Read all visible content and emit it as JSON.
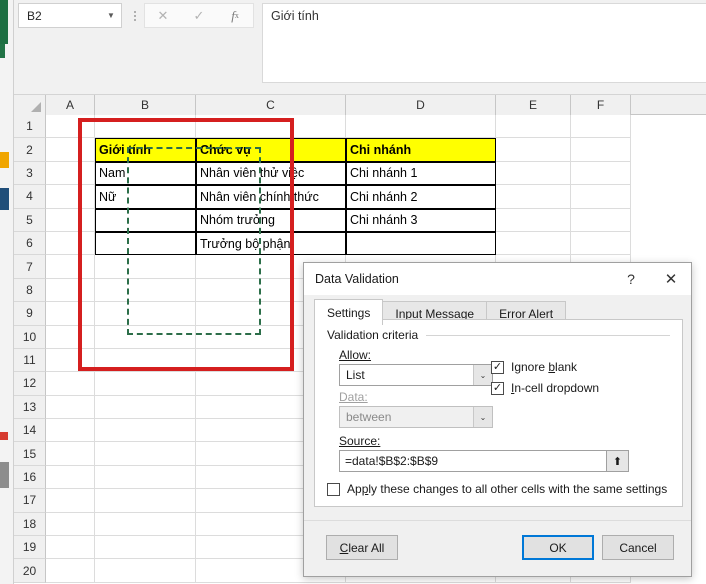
{
  "formula_bar": {
    "name_box_value": "B2",
    "name_box_caret": "▼",
    "cancel_icon": "✕",
    "enter_icon": "✓",
    "fx_label": "f",
    "fx_sub": "x",
    "cell_content": "Giới tính"
  },
  "grid": {
    "columns": [
      "A",
      "B",
      "C",
      "D",
      "E",
      "F"
    ],
    "rows": [
      "1",
      "2",
      "3",
      "4",
      "5",
      "6",
      "7",
      "8",
      "9",
      "10",
      "11",
      "12",
      "13",
      "14",
      "15",
      "16",
      "17",
      "18",
      "19",
      "20"
    ],
    "data": {
      "B2": "Giới tính",
      "C2": "Chức vụ",
      "D2": "Chi nhánh",
      "B3": "Nam",
      "C3": "Nhân viên thử việc",
      "D3": "Chi nhánh 1",
      "B4": "Nữ",
      "C4": "Nhân viên chính thức",
      "D4": "Chi nhánh 2",
      "C5": "Nhóm trưởng",
      "D5": "Chi nhánh 3",
      "C6": "Trưởng bộ phận"
    },
    "header_fill": "#ffff00",
    "selection_range": "B2:B9",
    "selection_color": "#2c6e49",
    "annotation_color": "#d51f1f"
  },
  "dialog": {
    "title": "Data Validation",
    "help_icon": "?",
    "close_icon": "✕",
    "tabs": [
      {
        "label": "Settings",
        "active": true
      },
      {
        "label": "Input Message",
        "active": false
      },
      {
        "label": "Error Alert",
        "active": false
      }
    ],
    "group_label": "Validation criteria",
    "allow_label": "Allow:",
    "allow_value": "List",
    "data_label": "Data:",
    "data_value": "between",
    "source_label": "Source:",
    "source_value": "=data!$B$2:$B$9",
    "range_picker_icon": "⬆",
    "dropdown_caret": "⌄",
    "checkboxes": [
      {
        "label_pre": "Ignore ",
        "label_key": "b",
        "label_post": "lank",
        "checked": true,
        "check_glyph": "✓"
      },
      {
        "label_pre": "",
        "label_key": "I",
        "label_post": "n-cell dropdown",
        "checked": true,
        "check_glyph": "✓"
      }
    ],
    "apply_all": {
      "label_pre": "Ap",
      "label_key": "p",
      "label_post": "ly these changes to all other cells with the same settings",
      "checked": false,
      "check_glyph": ""
    },
    "buttons": {
      "clear_all_pre": "",
      "clear_all_key": "C",
      "clear_all_post": "lear All",
      "ok": "OK",
      "cancel": "Cancel"
    }
  }
}
